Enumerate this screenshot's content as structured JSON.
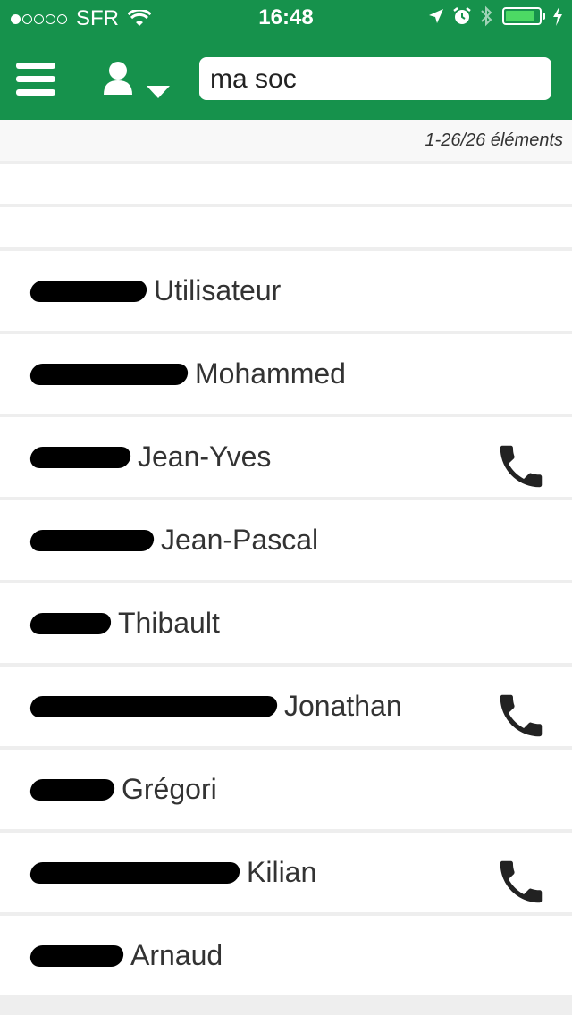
{
  "status_bar": {
    "carrier": "SFR",
    "time": "16:48",
    "signal_dots_filled": 1,
    "signal_dots_total": 5,
    "battery_level": 0.9
  },
  "toolbar": {
    "menu_icon": "hamburger-menu-icon",
    "user_icon": "user-icon",
    "search_value": "ma soc"
  },
  "results": {
    "count_label": "1-26/26 éléments"
  },
  "contacts": [
    {
      "first_name": "Utilisateur",
      "has_phone": false
    },
    {
      "first_name": "Mohammed",
      "has_phone": false
    },
    {
      "first_name": "Jean-Yves",
      "has_phone": true
    },
    {
      "first_name": "Jean-Pascal",
      "has_phone": false
    },
    {
      "first_name": "Thibault",
      "has_phone": false
    },
    {
      "first_name": "Jonathan",
      "has_phone": true
    },
    {
      "first_name": "Grégori",
      "has_phone": false
    },
    {
      "first_name": "Kilian",
      "has_phone": true
    },
    {
      "first_name": "Arnaud",
      "has_phone": false
    }
  ],
  "colors": {
    "header_green": "#16924c",
    "battery_green": "#4cd964"
  }
}
